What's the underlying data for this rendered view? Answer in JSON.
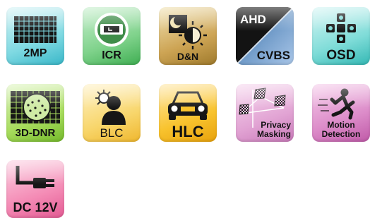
{
  "features": [
    {
      "id": "2mp",
      "label": "2MP",
      "icon": "sensor-grid-icon"
    },
    {
      "id": "icr",
      "label": "ICR",
      "icon": "ir-cut-filter-icon"
    },
    {
      "id": "dn",
      "label": "D&N",
      "icon": "day-night-icon"
    },
    {
      "id": "ahd_cvbs",
      "label_top": "AHD",
      "label_bottom": "CVBS",
      "icon": "dual-output-icon"
    },
    {
      "id": "osd",
      "label": "OSD",
      "icon": "dpad-icon"
    },
    {
      "id": "3ddnr",
      "label": "3D-DNR",
      "icon": "noise-reduction-icon"
    },
    {
      "id": "blc",
      "label": "BLC",
      "icon": "backlight-person-icon"
    },
    {
      "id": "hlc",
      "label": "HLC",
      "icon": "car-headlight-icon"
    },
    {
      "id": "privacy",
      "label_line1": "Privacy",
      "label_line2": "Masking",
      "icon": "privacy-mask-icon"
    },
    {
      "id": "motion",
      "label_line1": "Motion",
      "label_line2": "Detection",
      "icon": "running-man-icon"
    },
    {
      "id": "dc12v",
      "label": "DC 12V",
      "icon": "power-plug-icon"
    }
  ],
  "colors": {
    "2mp": "#7fd9e2",
    "icr": "#7fd28b",
    "dn": "#cda454",
    "ahd_cvbs": "#6f9ac8",
    "osd": "#7fdcd8",
    "3ddnr": "#a9dd5f",
    "blc": "#f8d66c",
    "hlc": "#f8c32e",
    "privacy": "#e2a4d4",
    "motion": "#dc8cc9",
    "dc12v": "#f48bb5"
  }
}
